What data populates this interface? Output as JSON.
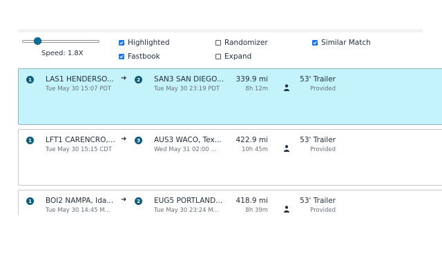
{
  "controls": {
    "speed_label": "Speed: 1.8X",
    "speed_value": 1.8,
    "checkboxes": [
      {
        "label": "Highlighted",
        "checked": true
      },
      {
        "label": "Fastbook",
        "checked": true
      },
      {
        "label": "Randomizer",
        "checked": false
      },
      {
        "label": "Expand",
        "checked": false
      },
      {
        "label": "Similar Match",
        "checked": true
      }
    ]
  },
  "loads": [
    {
      "origin_stop": "1",
      "origin": "LAS1 HENDERSO...",
      "origin_time": "Tue May 30 15:07 PDT",
      "dest_stop": "2",
      "destination": "SAN3 SAN DIEGO...",
      "dest_time": "Tue May 30 23:19 PDT",
      "distance": "339.9 mi",
      "duration": "8h 12m",
      "equipment": "53' Trailer",
      "equipment_status": "Provided",
      "highlighted": true
    },
    {
      "origin_stop": "1",
      "origin": "LFT1 CARENCRO,...",
      "origin_time": "Tue May 30 15:15 CDT",
      "dest_stop": "3",
      "destination": "AUS3 WACO, Tex...",
      "dest_time": "Wed May 31 02:00 ...",
      "distance": "422.9 mi",
      "duration": "10h 45m",
      "equipment": "53' Trailer",
      "equipment_status": "Provided",
      "highlighted": false
    },
    {
      "origin_stop": "1",
      "origin": "BOI2 NAMPA, Ida...",
      "origin_time": "Tue May 30 14:45 M...",
      "dest_stop": "2",
      "destination": "EUG5 PORTLAND...",
      "dest_time": "Tue May 30 23:24 M...",
      "distance": "418.9 mi",
      "duration": "8h 39m",
      "equipment": "53' Trailer",
      "equipment_status": "Provided",
      "highlighted": false
    }
  ],
  "colors": {
    "highlight_bg": "#c4f3fc",
    "stop_badge": "#0d5b7c",
    "checkbox_on": "#1a73e8"
  }
}
